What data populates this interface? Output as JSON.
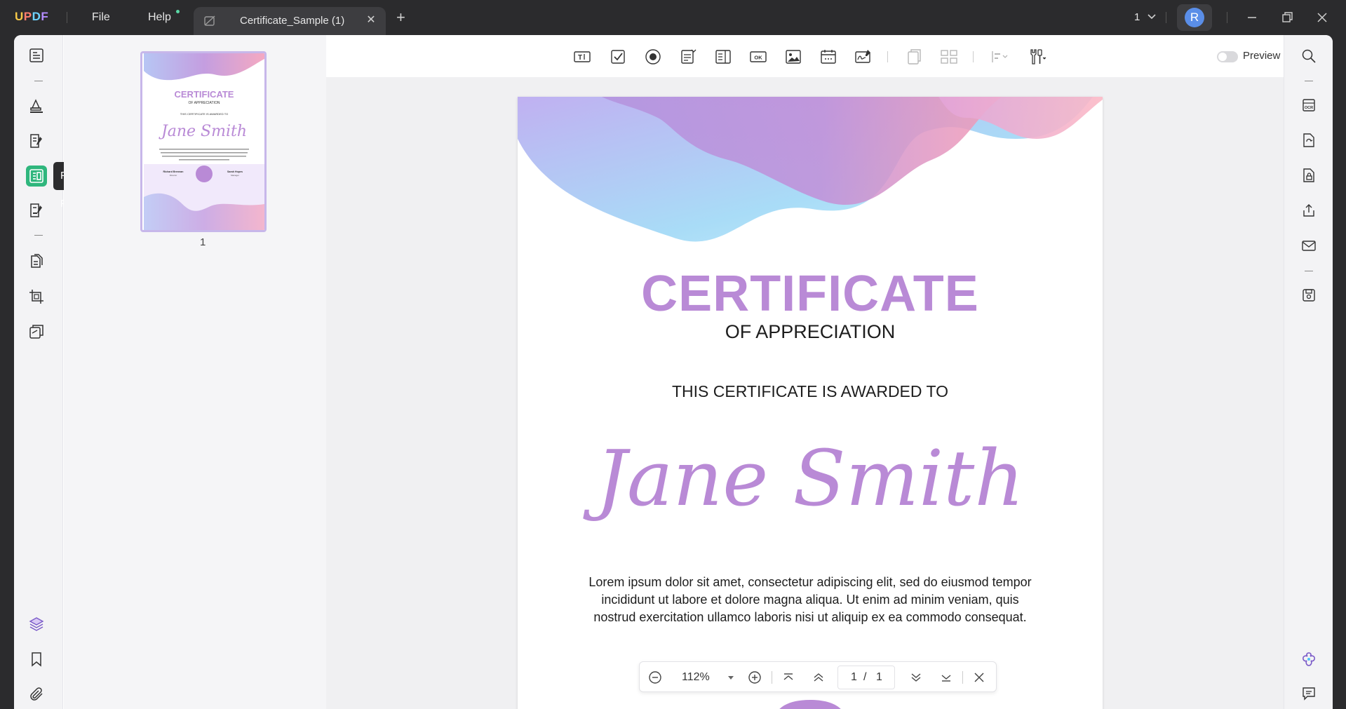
{
  "app": {
    "logo": {
      "u": "U",
      "p": "P",
      "d": "D",
      "f": "F"
    },
    "menu": {
      "file": "File",
      "help": "Help"
    },
    "tab": {
      "title": "Certificate_Sample (1)"
    },
    "page_indicator": "1",
    "avatar_initial": "R"
  },
  "left_rail": {
    "tooltip": "Prepare Form"
  },
  "thumbnails": {
    "page_number": "1",
    "mini": {
      "title": "CERTIFICATE",
      "subtitle": "OF APPRECIATION",
      "awarded": "THIS CERTIFICATE IS AWARDED TO",
      "name": "Jane Smith",
      "sig_left_name": "Richard Brennan",
      "sig_left_role": "Director",
      "sig_right_name": "Sarah Hopes",
      "sig_right_role": "Manager"
    }
  },
  "toolbar": {
    "preview_label": "Preview"
  },
  "document": {
    "title": "CERTIFICATE",
    "subtitle": "OF APPRECIATION",
    "awarded_to": "THIS CERTIFICATE IS AWARDED TO",
    "recipient": "Jane Smith",
    "body": "Lorem ipsum dolor sit amet, consectetur adipiscing elit, sed do eiusmod tempor incididunt ut labore et dolore magna aliqua. Ut enim ad minim veniam, quis nostrud exercitation ullamco laboris nisi ut aliquip ex ea commodo consequat."
  },
  "zoom_bar": {
    "zoom": "112%",
    "current_page": "1",
    "separator": "/",
    "total_pages": "1"
  },
  "colors": {
    "accent_green": "#2fb67d",
    "certificate_purple": "#b98ad6"
  }
}
